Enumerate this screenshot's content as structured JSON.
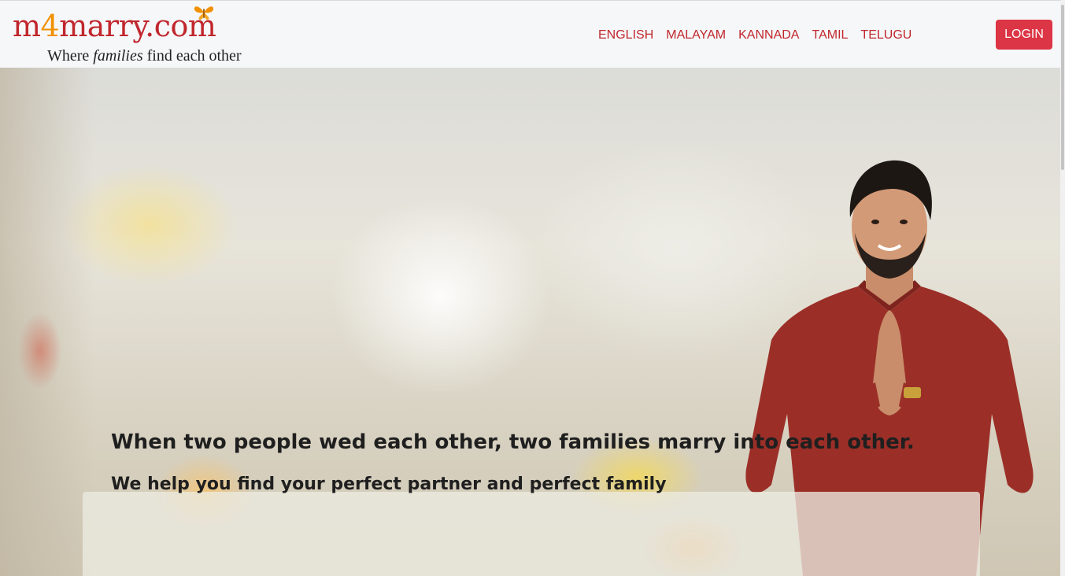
{
  "brand": {
    "logo_prefix": "m",
    "logo_four": "4",
    "logo_suffix": "marry.com",
    "tagline_start": "Where ",
    "tagline_emphasis": "families",
    "tagline_end": " find each other",
    "primary_color": "#c0272d",
    "accent_color": "#f29100"
  },
  "nav": {
    "languages": [
      {
        "label": "ENGLISH"
      },
      {
        "label": "MALAYAM"
      },
      {
        "label": "KANNADA"
      },
      {
        "label": "TAMIL"
      },
      {
        "label": "TELUGU"
      }
    ],
    "login_label": "LOGIN",
    "login_color": "#dc3545"
  },
  "hero": {
    "title": "When two people wed each other, two families marry into each other.",
    "subtitle": "We help you find your perfect partner and perfect family"
  }
}
